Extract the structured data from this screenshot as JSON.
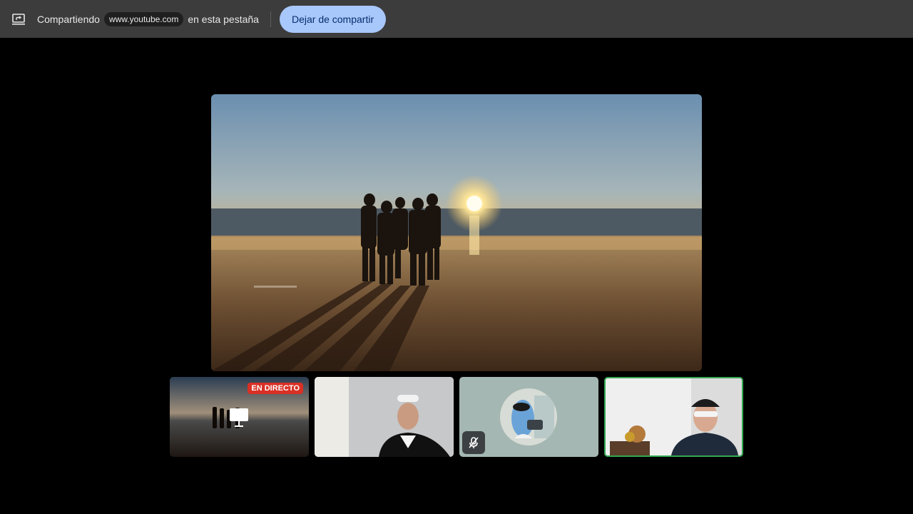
{
  "share_bar": {
    "prefix": "Compartiendo",
    "url": "www.youtube.com",
    "suffix": "en esta pestaña",
    "stop_label": "Dejar de compartir",
    "icon": "screen-share-icon"
  },
  "stage": {
    "content": "beach-sunset-video"
  },
  "participants": [
    {
      "badge": "EN DIRECTO",
      "icon": "presentation-icon"
    },
    {
      "icon": "camera-feed"
    },
    {
      "icon": "mic-off-icon"
    },
    {
      "icon": "camera-feed",
      "speaking": true
    }
  ],
  "colors": {
    "bar_bg": "#3c3c3c",
    "button_bg": "#a8c7fa",
    "button_text": "#062e6f",
    "live_badge": "#d93025",
    "speaking_border": "#34a853"
  }
}
